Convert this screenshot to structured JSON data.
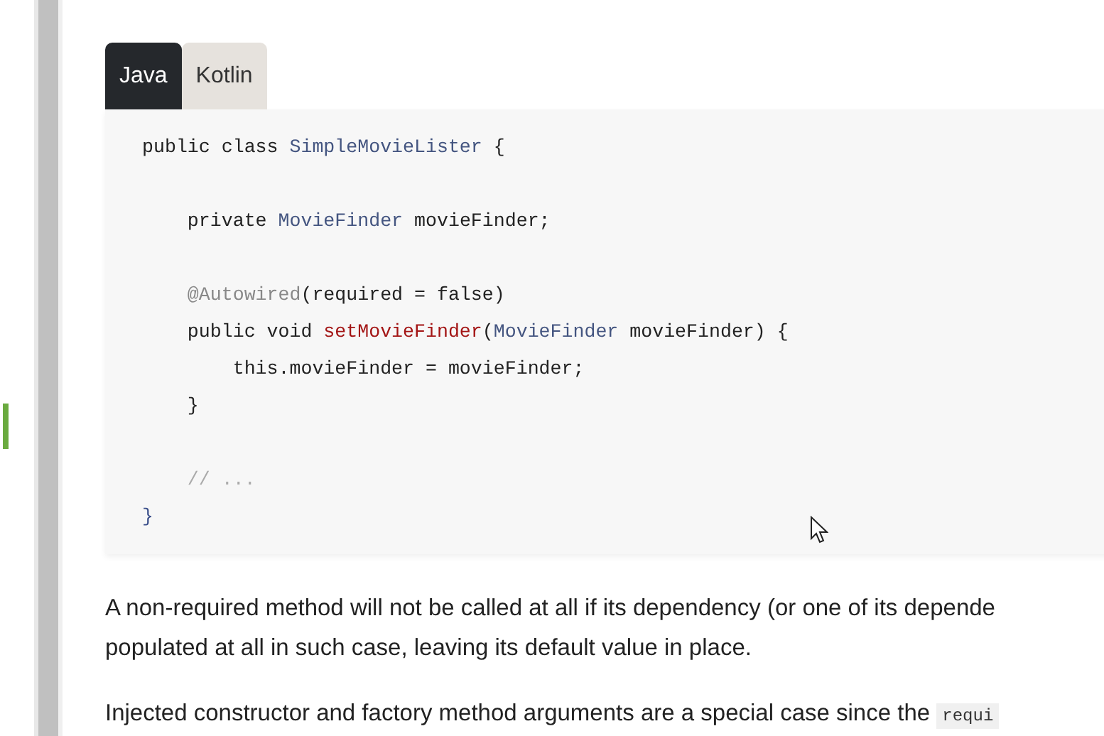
{
  "tabs": [
    {
      "label": "Java",
      "selected": true
    },
    {
      "label": "Kotlin",
      "selected": false
    }
  ],
  "code_lines": [
    {
      "kind": "code",
      "tokens": [
        {
          "kind": "keyword",
          "text": "public class "
        },
        {
          "kind": "type",
          "text": "SimpleMovieLister"
        },
        {
          "kind": "plain",
          "text": " {"
        }
      ]
    },
    {
      "kind": "blank"
    },
    {
      "kind": "code",
      "tokens": [
        {
          "kind": "keyword",
          "text": "    private "
        },
        {
          "kind": "type",
          "text": "MovieFinder"
        },
        {
          "kind": "plain",
          "text": " movieFinder;"
        }
      ]
    },
    {
      "kind": "blank"
    },
    {
      "kind": "code",
      "tokens": [
        {
          "kind": "annotation",
          "text": "    @Autowired"
        },
        {
          "kind": "plain",
          "text": "(required = false)"
        }
      ]
    },
    {
      "kind": "code",
      "tokens": [
        {
          "kind": "keyword",
          "text": "    public void "
        },
        {
          "kind": "method",
          "text": "setMovieFinder"
        },
        {
          "kind": "plain",
          "text": "("
        },
        {
          "kind": "type",
          "text": "MovieFinder"
        },
        {
          "kind": "plain",
          "text": " movieFinder) {"
        }
      ]
    },
    {
      "kind": "code",
      "tokens": [
        {
          "kind": "keyword",
          "text": "        this"
        },
        {
          "kind": "plain",
          "text": ".movieFinder = movieFinder;"
        }
      ]
    },
    {
      "kind": "code",
      "tokens": [
        {
          "kind": "plain",
          "text": "    }"
        }
      ]
    },
    {
      "kind": "blank"
    },
    {
      "kind": "code",
      "tokens": [
        {
          "kind": "comment",
          "text": "    // ..."
        }
      ]
    },
    {
      "kind": "code",
      "tokens": [
        {
          "kind": "brace",
          "text": "}"
        }
      ]
    }
  ],
  "paragraphs": [
    {
      "lines": [
        {
          "text": "A non-required method will not be called at all if its dependency (or one of its depende"
        },
        {
          "text": "populated at all in such case, leaving its default value in place."
        }
      ]
    },
    {
      "lines": [
        {
          "text": "Injected constructor and factory method arguments are a special case since the ",
          "code": "requi"
        }
      ]
    }
  ]
}
